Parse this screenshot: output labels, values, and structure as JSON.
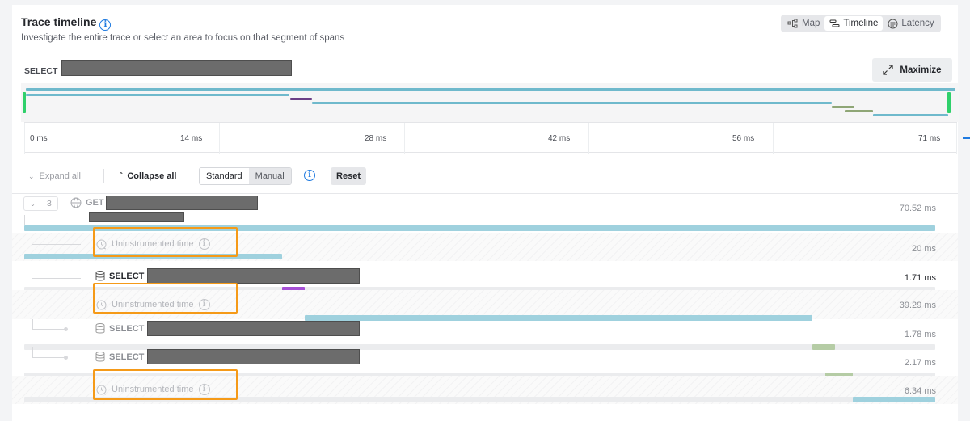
{
  "header": {
    "title": "Trace timeline",
    "subtitle": "Investigate the entire trace or select an area to focus on that segment of spans",
    "view_options": [
      {
        "label": "Map",
        "icon": "map-icon",
        "selected": false
      },
      {
        "label": "Timeline",
        "icon": "timeline-icon",
        "selected": true
      },
      {
        "label": "Latency",
        "icon": "latency-icon",
        "selected": false
      }
    ],
    "maximize_label": "Maximize"
  },
  "overview": {
    "selected_label": "SELECT",
    "axis_ticks": [
      "0 ms",
      "14 ms",
      "28 ms",
      "42 ms",
      "56 ms",
      "71 ms"
    ]
  },
  "toolbar": {
    "expand_all": "Expand all",
    "collapse_all": "Collapse all",
    "mode_standard": "Standard",
    "mode_manual": "Manual",
    "reset": "Reset"
  },
  "tree": {
    "root": {
      "count": "3",
      "method": "GET",
      "duration": "70.52 ms"
    },
    "rows": [
      {
        "type": "uninstrumented",
        "label": "Uninstrumented time",
        "duration": "20 ms"
      },
      {
        "type": "span",
        "label": "SELECT",
        "duration": "1.71 ms"
      },
      {
        "type": "uninstrumented",
        "label": "Uninstrumented time",
        "duration": "39.29 ms"
      },
      {
        "type": "span",
        "label": "SELECT",
        "duration": "1.78 ms"
      },
      {
        "type": "span",
        "label": "SELECT",
        "duration": "2.17 ms"
      },
      {
        "type": "uninstrumented",
        "label": "Uninstrumented time",
        "duration": "6.34 ms"
      }
    ]
  },
  "colors": {
    "http": "#9fd1de",
    "uninstrumented": "#9fd1de",
    "db_purple": "#a64fd6",
    "db_green": "#b5cca5",
    "highlight": "#f59a18",
    "handle": "#2fd06b"
  }
}
